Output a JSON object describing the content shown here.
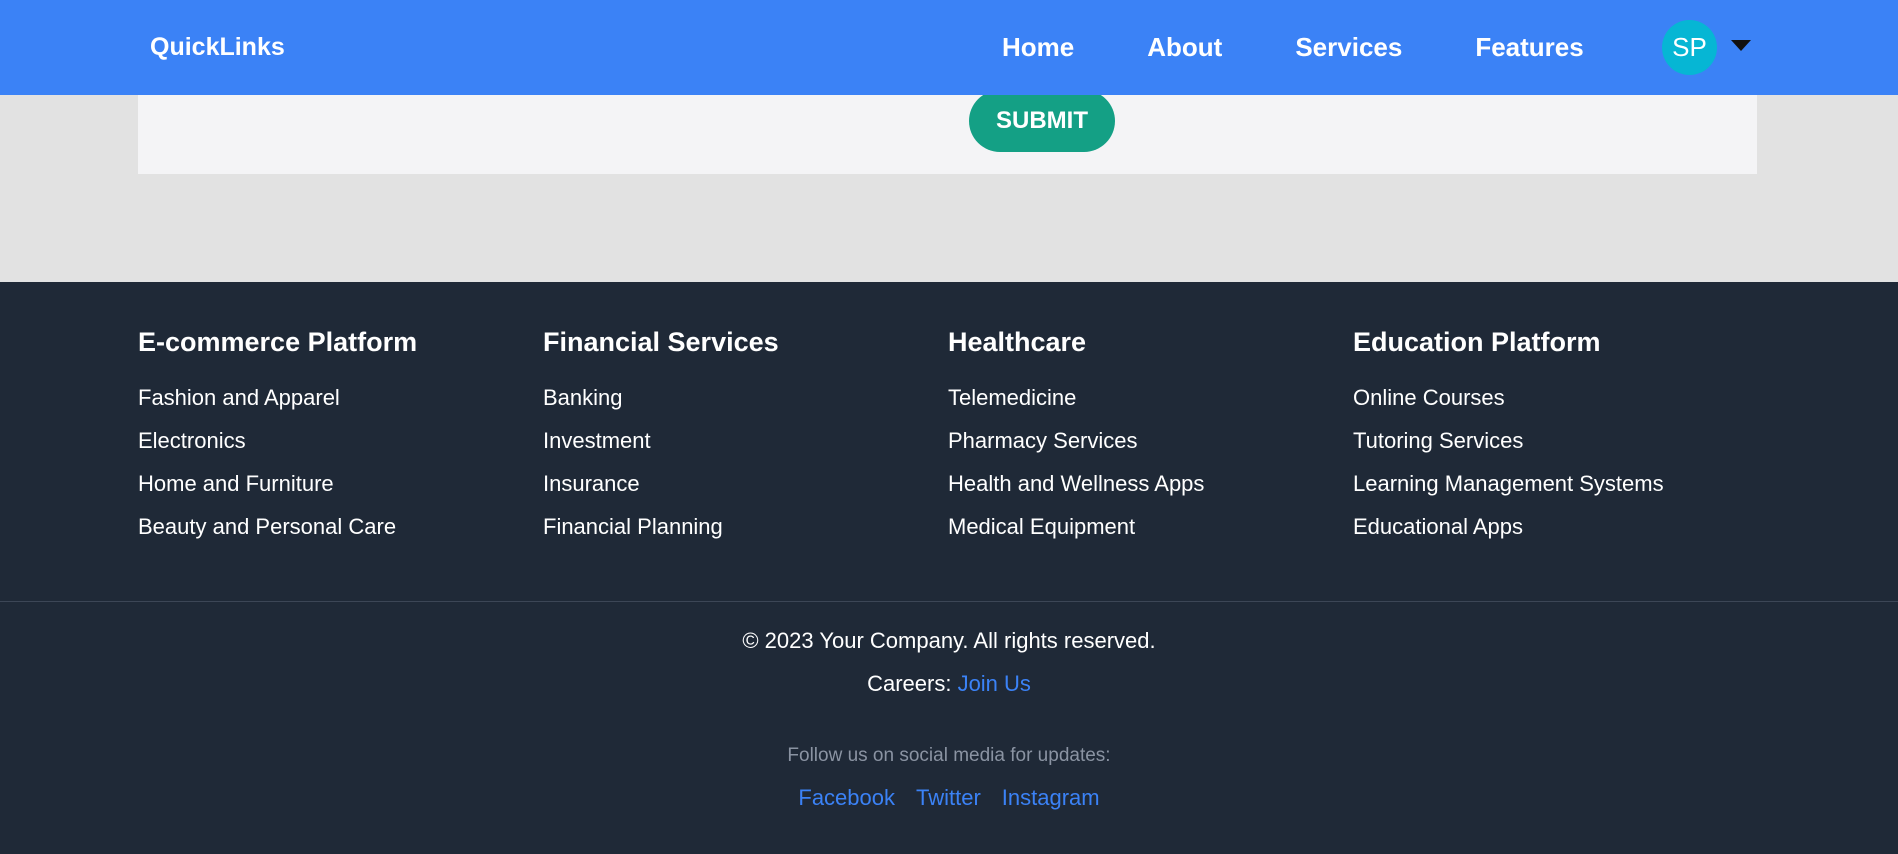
{
  "navbar": {
    "brand": "QuickLinks",
    "links": [
      "Home",
      "About",
      "Services",
      "Features"
    ],
    "avatar_initials": "SP",
    "dropdown_icon": "caret-down-icon",
    "background": "#3b82f6"
  },
  "form": {
    "submit_label": "SUBMIT",
    "submit_color": "#14a085"
  },
  "footer": {
    "columns": [
      {
        "title": "E-commerce Platform",
        "items": [
          "Fashion and Apparel",
          "Electronics",
          "Home and Furniture",
          "Beauty and Personal Care"
        ]
      },
      {
        "title": "Financial Services",
        "items": [
          "Banking",
          "Investment",
          "Insurance",
          "Financial Planning"
        ]
      },
      {
        "title": "Healthcare",
        "items": [
          "Telemedicine",
          "Pharmacy Services",
          "Health and Wellness Apps",
          "Medical Equipment"
        ]
      },
      {
        "title": "Education Platform",
        "items": [
          "Online Courses",
          "Tutoring Services",
          "Learning Management Systems",
          "Educational Apps"
        ]
      }
    ],
    "copyright": "© 2023 Your Company. All rights reserved.",
    "careers_label": "Careers:",
    "careers_link": "Join Us",
    "follow_text": "Follow us on social media for updates:",
    "social_links": [
      "Facebook",
      "Twitter",
      "Instagram"
    ],
    "background": "#1f2937",
    "link_color": "#3b82f6"
  }
}
